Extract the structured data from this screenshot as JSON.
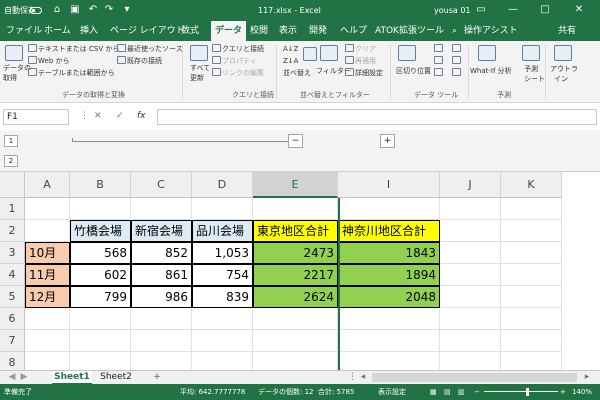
{
  "titlebar": {
    "autosave": "自動保存",
    "file_title": "117.xlsx - Excel",
    "user": "yousa 01",
    "min": "—",
    "max": "□",
    "close": "✕"
  },
  "tabs": [
    "ファイル",
    "ホーム",
    "挿入",
    "ページ レイアウト",
    "数式",
    "データ",
    "校閲",
    "表示",
    "開発",
    "ヘルプ",
    "ATOK拡張ツール"
  ],
  "active_tab": "データ",
  "search_label": "操作アシスト",
  "share_label": "共有",
  "ribbon": {
    "get_data": [
      "データの",
      "取得"
    ],
    "text_csv": "テキストまたは CSV から",
    "web": "Web から",
    "table_range": "テーブルまたは範囲から",
    "recent": "最近使ったソース",
    "existing": "既存の接続",
    "group1": "データの取得と変換",
    "refresh_all": [
      "すべて",
      "更新"
    ],
    "queries": "クエリと接続",
    "properties": "プロパティ",
    "edit_links": "リンクの編集",
    "group2": "クエリと接続",
    "sort_label": "並べ替え",
    "filter": "フィルター",
    "clear": "クリア",
    "reapply": "再適用",
    "advanced": "詳細設定",
    "group3": "並べ替えとフィルター",
    "text_to_columns": "区切り位置",
    "group4": "データ ツール",
    "whatif": "What-If 分析",
    "forecast_sheet": [
      "予測",
      "シート"
    ],
    "outline": [
      "アウトラ",
      "イン"
    ],
    "group5": "予測"
  },
  "formula": {
    "namebox": "F1",
    "cancel": "✕",
    "enter": "✓",
    "fx": "fx",
    "value": ""
  },
  "outline": {
    "levels": [
      "1",
      "2"
    ],
    "collapse": "−",
    "expand": "+"
  },
  "columns": [
    "A",
    "B",
    "C",
    "D",
    "E",
    "I",
    "J",
    "K"
  ],
  "rows": [
    "1",
    "2",
    "3",
    "4",
    "5",
    "6",
    "7",
    "8"
  ],
  "table": {
    "headers": [
      "竹橋会場",
      "新宿会場",
      "品川会場",
      "東京地区合計",
      "神奈川地区合計"
    ],
    "months": [
      "10月",
      "11月",
      "12月"
    ],
    "data": [
      [
        "568",
        "852",
        "1,053",
        "2473",
        "1843"
      ],
      [
        "602",
        "861",
        "754",
        "2217",
        "1894"
      ],
      [
        "799",
        "986",
        "839",
        "2624",
        "2048"
      ]
    ]
  },
  "sheets": [
    "Sheet1",
    "Sheet2"
  ],
  "add_sheet": "+",
  "status": {
    "ready": "準備完了",
    "average": "平均: 642.7777778",
    "count": "データの個数: 12",
    "sum": "合計: 5785",
    "display": "表示設定",
    "zoom": "140%"
  }
}
